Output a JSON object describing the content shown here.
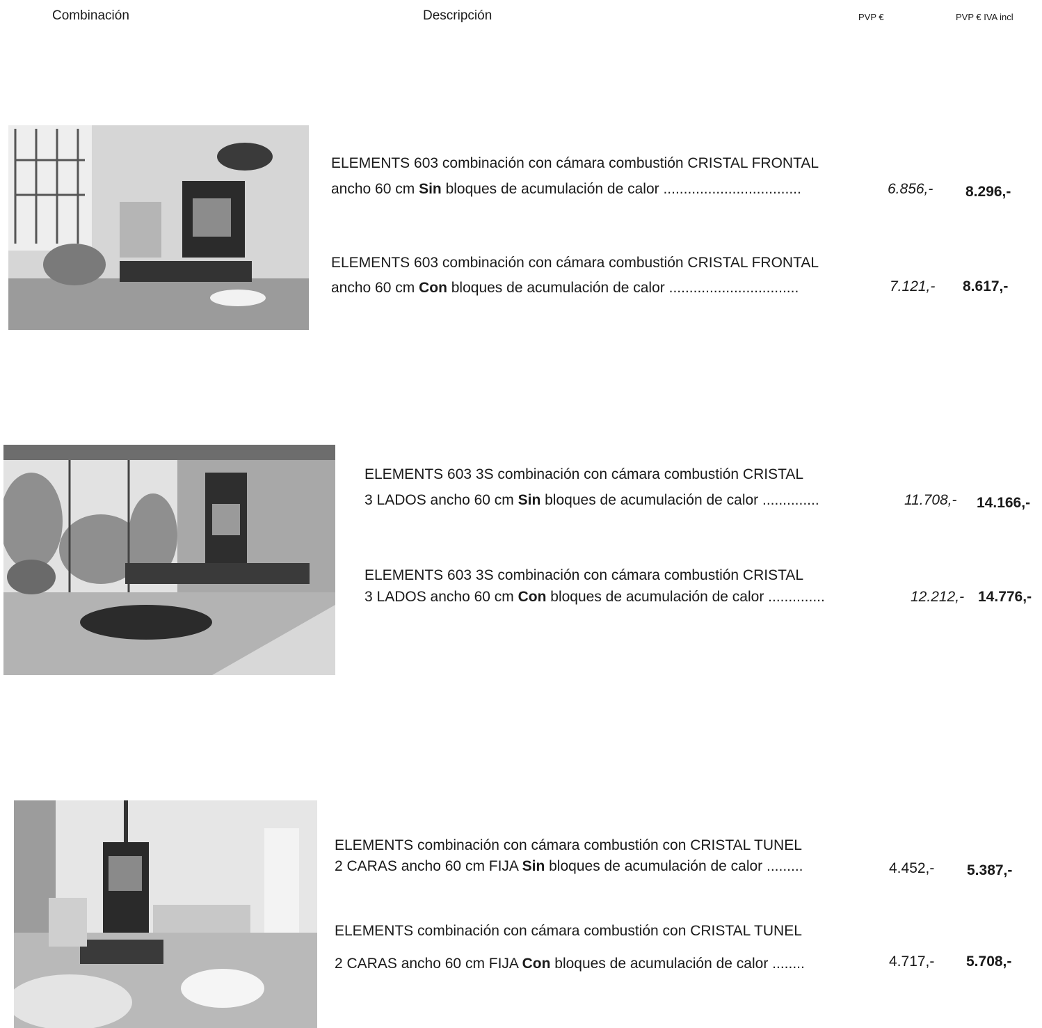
{
  "header": {
    "combination": "Combinación",
    "description": "Descripción",
    "price": "PVP €",
    "price_vat": "PVP € IVA incl"
  },
  "products": [
    {
      "image_label": "living-room-fireplace-photo",
      "items": [
        {
          "line1": "ELEMENTS 603 combinación con cámara combustión CRISTAL FRONTAL",
          "line2_pre": "ancho 60 cm ",
          "line2_bold": "Sin",
          "line2_post": " bloques de acumulación de calor ..................................",
          "price": "6.856,-",
          "price_vat": "8.296,-"
        },
        {
          "line1": "ELEMENTS 603  combinación con cámara combustión CRISTAL FRONTAL",
          "line2_pre": "ancho 60 cm ",
          "line2_bold": "Con",
          "line2_post": " bloques de acumulación de calor ................................",
          "price": "7.121,-",
          "price_vat": "8.617,-"
        }
      ]
    },
    {
      "image_label": "stone-wall-fireplace-photo",
      "items": [
        {
          "line1": "ELEMENTS 603 3S combinación con cámara combustión CRISTAL",
          "line2_pre": "3 LADOS ancho 60 cm ",
          "line2_bold": "Sin",
          "line2_post": " bloques de acumulación de calor ..............",
          "price": "11.708,-",
          "price_vat": "14.166,-"
        },
        {
          "line1": "ELEMENTS 603 3S combinación con cámara combustión CRISTAL",
          "line2_pre": "3 LADOS ancho 60 cm ",
          "line2_bold": "Con",
          "line2_post": " bloques de acumulación de calor ..............",
          "price": "12.212,-",
          "price_vat": "14.776,-"
        }
      ]
    },
    {
      "image_label": "freestanding-tunnel-fireplace-photo",
      "items": [
        {
          "line1": "ELEMENTS combinación con cámara combustión con CRISTAL TUNEL",
          "line2_pre": "2 CARAS ancho 60 cm FIJA ",
          "line2_bold": "Sin",
          "line2_post": " bloques de acumulación de calor .........",
          "price": "4.452,-",
          "price_vat": "5.387,-"
        },
        {
          "line1": "ELEMENTS combinación con cámara combustión con CRISTAL TUNEL",
          "line2_pre": "2 CARAS ancho 60 cm FIJA ",
          "line2_bold": "Con",
          "line2_post": " bloques de acumulación de calor ........",
          "price": "4.717,-",
          "price_vat": "5.708,-"
        }
      ]
    }
  ]
}
